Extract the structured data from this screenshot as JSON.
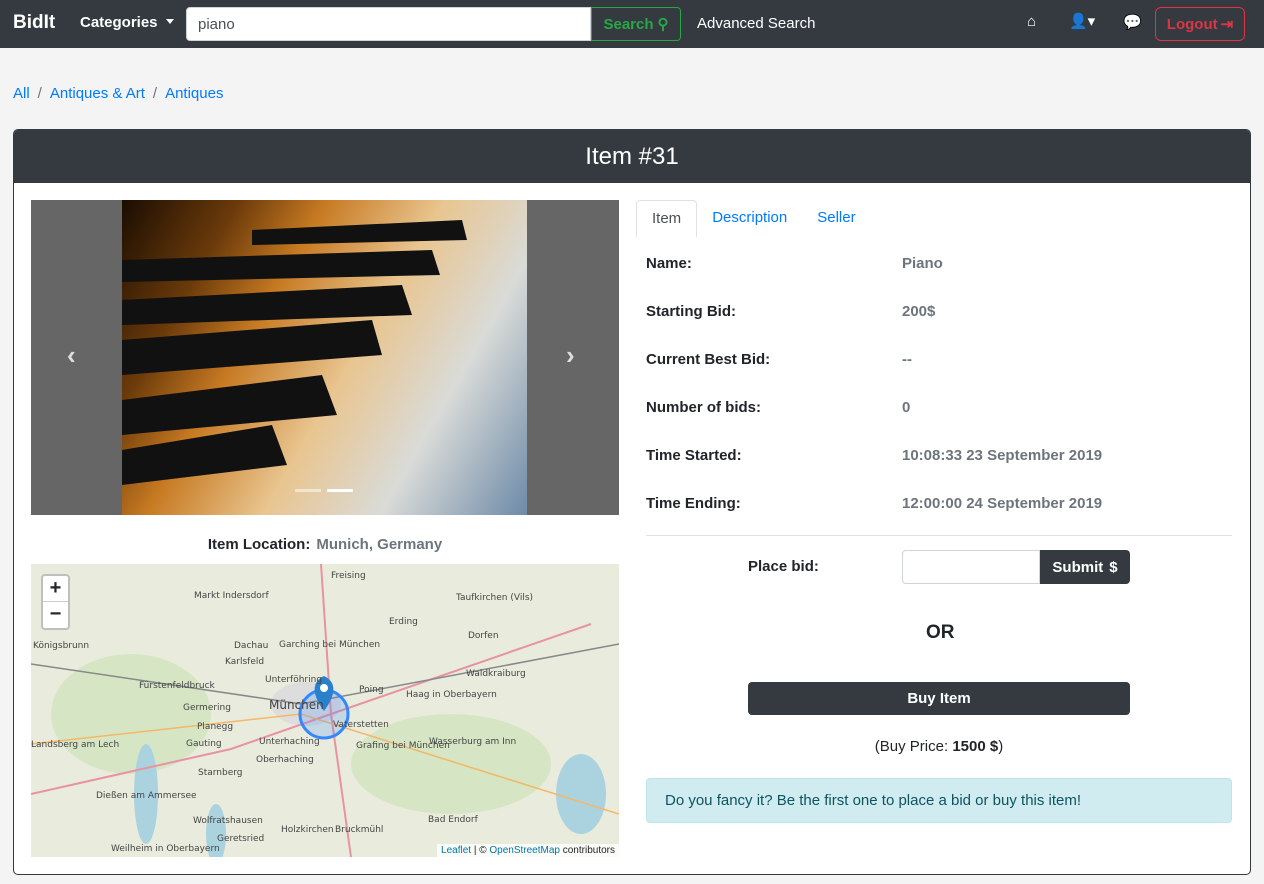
{
  "nav": {
    "brand": "BidIt",
    "categories": "Categories",
    "search_value": "piano",
    "search_label": "Search",
    "advanced": "Advanced Search",
    "logout": "Logout"
  },
  "breadcrumb": [
    "All",
    "Antiques & Art",
    "Antiques"
  ],
  "card": {
    "title": "Item #31"
  },
  "carousel": {
    "prev": "‹",
    "next": "›",
    "slides": 2,
    "active": 1
  },
  "location": {
    "label": "Item Location:",
    "value": "Munich, Germany"
  },
  "map": {
    "zoom_in": "+",
    "zoom_out": "−",
    "attribution_leaflet": "Leaflet",
    "attribution_sep": " | © ",
    "attribution_osm": "OpenStreetMap",
    "attribution_tail": " contributors",
    "labels": [
      "Freising",
      "Markt Indersdorf",
      "Taufkirchen (Vils)",
      "Erding",
      "Dachau",
      "Garching bei München",
      "Dorfen",
      "Karlsfeld",
      "Fürstenfeldbruck",
      "Unterföhring",
      "Poing",
      "Waldkraiburg",
      "Haag in Oberbayern",
      "Germering",
      "München",
      "Vaterstetten",
      "Planegg",
      "Gauting",
      "Unterhaching",
      "Grafing bei München",
      "Wasserburg am Inn",
      "Oberhaching",
      "Landsberg am Lech",
      "Starnberg",
      "Dießen am Ammersee",
      "Wolfratshausen",
      "Holzkirchen",
      "Bruckmühl",
      "Bad Endorf",
      "Geretsried",
      "Weilheim in Oberbayern",
      "Königsbrunn"
    ]
  },
  "tabs": [
    {
      "label": "Item",
      "active": true
    },
    {
      "label": "Description"
    },
    {
      "label": "Seller"
    }
  ],
  "details": [
    {
      "label": "Name:",
      "value": "Piano"
    },
    {
      "label": "Starting Bid:",
      "value": "200$"
    },
    {
      "label": "Current Best Bid:",
      "value": "--"
    },
    {
      "label": "Number of bids:",
      "value": "0"
    },
    {
      "label": "Time Started:",
      "value": "10:08:33 23 September 2019"
    },
    {
      "label": "Time Ending:",
      "value": "12:00:00 24 September 2019"
    }
  ],
  "bid": {
    "label": "Place bid:",
    "value": "",
    "submit": "Submit",
    "or": "OR",
    "buy": "Buy Item",
    "price_prefix": "(Buy Price: ",
    "price": "1500 $",
    "price_suffix": ")"
  },
  "alert": "Do you fancy it? Be the first one to place a bid or buy this item!",
  "colors": {
    "navbar": "#343a40",
    "link": "#007bff",
    "search": "#28a745",
    "logout": "#dc3545",
    "alert_bg": "#d1ecf1"
  }
}
